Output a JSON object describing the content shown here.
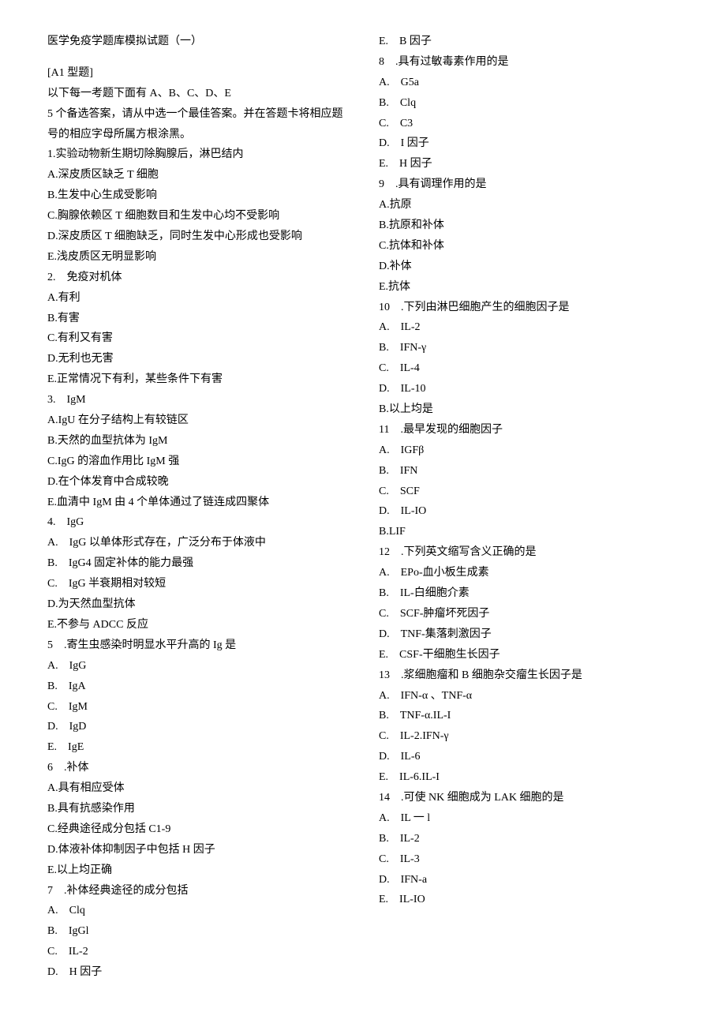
{
  "title": "医学免疫学题库模拟试题（一）",
  "section_header": "[A1 型题]",
  "instruction_l1": "以下每一考题下面有 A、B、C、D、E",
  "instruction_l2": "5 个备选答案，请从中选一个最佳答案。并在答题卡将相应题号的相应字母所属方根涂黑。",
  "q1": {
    "stem": "1.实验动物新生期切除胸腺后，淋巴结内",
    "a": "A.深皮质区缺乏 T 细胞",
    "b": "B.生发中心生成受影响",
    "c": "C.胸腺依赖区 T 细胞数目和生发中心均不受影响",
    "d": "D.深皮质区 T 细胞缺乏，同时生发中心形成也受影响",
    "e": "E.浅皮质区无明显影响"
  },
  "q2": {
    "stem": "2. 免疫对机体",
    "a": "A.有利",
    "b": "B.有害",
    "c": "C.有利又有害",
    "d": "D.无利也无害",
    "e": "E.正常情况下有利，某些条件下有害"
  },
  "q3": {
    "stem": "3. IgM",
    "a": "A.IgU 在分子结构上有较链区",
    "b": "B.天然的血型抗体为 IgM",
    "c": "C.IgG 的溶血作用比 IgM 强",
    "d": "D.在个体发育中合成较晚",
    "e": "E.血清中 IgM 由 4 个单体通过了链连成四聚体"
  },
  "q4": {
    "stem": "4. IgG",
    "a": "A. IgG 以单体形式存在，广泛分布于体液中",
    "b": "B. IgG4 固定补体的能力最强",
    "c": "C. IgG 半衰期相对较短",
    "d": "D.为天然血型抗体",
    "e": "E.不参与 ADCC 反应"
  },
  "q5": {
    "stem": "5 .寄生虫感染时明显水平升高的 Ig 是",
    "a": "A. IgG",
    "b": "B. IgA",
    "c": "C. IgM",
    "d": "D. IgD",
    "e": "E. IgE"
  },
  "q6": {
    "stem": "6 .补体",
    "a": "A.具有相应受体",
    "b": "B.具有抗感染作用",
    "c": "C.经典途径成分包括 C1-9",
    "d": "D.体液补体抑制因子中包括 H 因子",
    "e": "E.以上均正确"
  },
  "q7": {
    "stem": "7 .补体经典途径的成分包括",
    "a": "A. Clq",
    "b": "B. IgGl",
    "c": "C. IL-2",
    "d": "D. H 因子",
    "e": "E. B 因子"
  },
  "q8": {
    "stem": "8 .具有过敏毒素作用的是",
    "a": "A. G5a",
    "b": "B. Clq",
    "c": "C. C3",
    "d": "D. I 因子",
    "e": "E. H 因子"
  },
  "q9": {
    "stem": "9 .具有调理作用的是",
    "a": "A.抗原",
    "b": "B.抗原和补体",
    "c": "C.抗体和补体",
    "d": "D.补体",
    "e": "E.抗体"
  },
  "q10": {
    "stem": "10 .下列由淋巴细胞产生的细胞因子是",
    "a": "A. IL-2",
    "b": "B. IFN-γ",
    "c": "C. IL-4",
    "d": "D. IL-10",
    "e": "B.以上均是"
  },
  "q11": {
    "stem": "11 .最早发现的细胞因子",
    "a": "A. IGFβ",
    "b": "B. IFN",
    "c": "C. SCF",
    "d": "D. IL-IO",
    "e": "B.LIF"
  },
  "q12": {
    "stem": "12 .下列英文缩写含义正确的是",
    "a": "A. EPo-血小板生成素",
    "b": "B. IL-白细胞介素",
    "c": "C. SCF-肿瘤坏死因子",
    "d": "D. TNF-集落刺激因子",
    "e": "E. CSF-干细胞生长因子"
  },
  "q13": {
    "stem": "13 .浆细胞瘤和 B 细胞杂交瘤生长因子是",
    "a": "A. IFN-α 、TNF-α",
    "b": "B. TNF-α.IL-I",
    "c": "C. IL-2.IFN-γ",
    "d": "D. IL-6",
    "e": "E. IL-6.IL-I"
  },
  "q14": {
    "stem": "14 .可使 NK 细胞成为 LAK 细胞的是",
    "a": "A. IL 一 l",
    "b": "B. IL-2",
    "c": "C. IL-3",
    "d": "D. IFN-a",
    "e": "E. IL-IO"
  }
}
